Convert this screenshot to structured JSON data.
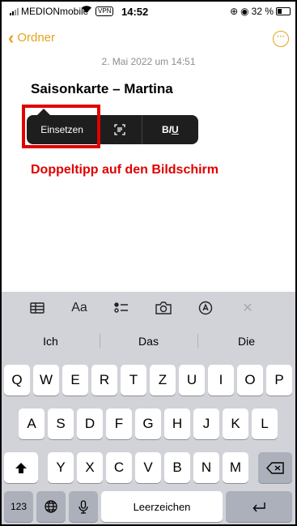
{
  "status": {
    "carrier": "MEDIONmobile",
    "vpn": "VPN",
    "time": "14:52",
    "battery": "32 %"
  },
  "nav": {
    "back_label": "Ordner",
    "accent_color": "#e5a41b"
  },
  "note": {
    "date": "2. Mai 2022 um 14:51",
    "title": "Saisonkarte – Martina"
  },
  "popup": {
    "paste_label": "Einsetzen",
    "format_label_b": "B",
    "format_label_i": "I",
    "format_label_u": "U"
  },
  "annotation": {
    "instruction": "Doppeltipp auf den Bildschirm",
    "color": "#e00000"
  },
  "toolbar": {
    "items": [
      "table-icon",
      "Aa",
      "checklist-icon",
      "camera-icon",
      "markup-icon",
      "close-icon"
    ],
    "format_label": "Aa"
  },
  "keyboard": {
    "suggestions": [
      "Ich",
      "Das",
      "Die"
    ],
    "row1": [
      "Q",
      "W",
      "E",
      "R",
      "T",
      "Z",
      "U",
      "I",
      "O",
      "P"
    ],
    "row2": [
      "A",
      "S",
      "D",
      "F",
      "G",
      "H",
      "J",
      "K",
      "L"
    ],
    "row3": [
      "Y",
      "X",
      "C",
      "V",
      "B",
      "N",
      "M"
    ],
    "numbers_label": "123",
    "space_label": "Leerzeichen"
  }
}
